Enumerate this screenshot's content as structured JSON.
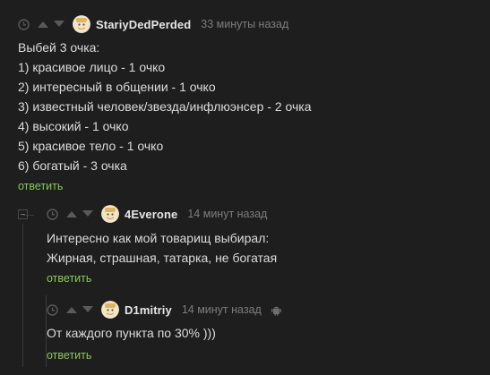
{
  "comments": [
    {
      "username": "StariyDedPerded",
      "time": "33 минуты назад",
      "lines": [
        "Выбей 3 очка:",
        "1) красивое лицо - 1 очко",
        "2) интересный в общении - 1 очко",
        "3) известный человек/звезда/инфлюэнсер - 2 очка",
        "4) высокий - 1 очко",
        "5) красивое тело - 1 очко",
        "6) богатый - 3 очка"
      ],
      "reply_label": "ответить"
    },
    {
      "username": "4Everone",
      "time": "14 минут назад",
      "lines": [
        "Интересно как мой товарищ выбирал:",
        "Жирная, страшная, татарка, не богатая"
      ],
      "reply_label": "ответить"
    },
    {
      "username": "D1mitriy",
      "time": "14 минут назад",
      "lines": [
        "От каждого пункта по 30% )))"
      ],
      "reply_label": "ответить"
    }
  ],
  "colors": {
    "background": "#1e1e1e",
    "text": "#dcdcdc",
    "username": "#e6e6e6",
    "time": "#7d7d7d",
    "reply": "#8ac858",
    "icon": "#5a5a5a"
  },
  "icons": {
    "clock": "clock-icon",
    "upvote": "upvote-arrow-icon",
    "downvote": "downvote-arrow-icon",
    "avatar": "avatar-default-icon",
    "platform": "android-icon",
    "collapse": "collapse-minus-icon"
  }
}
